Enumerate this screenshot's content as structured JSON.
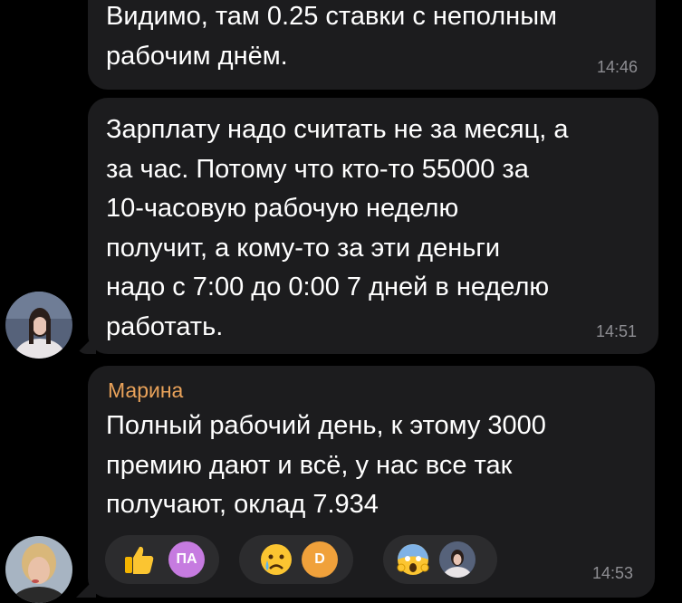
{
  "messages": [
    {
      "text": "Видимо, там 0.25 ставки с неполным\nрабочим днём.",
      "time": "14:46"
    },
    {
      "text": "Зарплату надо считать не за месяц, а\nза час. Потому что кто-то 55000 за\n10-часовую рабочую неделю\nполучит, а кому-то за эти деньги\nнадо с 7:00 до 0:00 7 дней в неделю\nработать.",
      "time": "14:51"
    },
    {
      "sender": "Марина",
      "text": "Полный рабочий день, к этому 3000\nпремию дают и всё, у нас все так\nполучают, оклад 7.934",
      "time": "14:53"
    }
  ],
  "reactions": [
    {
      "emoji": "thumbs-up-icon",
      "reactor_initials": "ПА",
      "reactor_color": "#c67be0"
    },
    {
      "emoji": "crying-face-icon",
      "reactor_initials": "D",
      "reactor_color": "#f0a13b"
    },
    {
      "emoji": "screaming-face-icon",
      "reactor_initials": "",
      "reactor_color": "#2b3a55"
    }
  ],
  "colors": {
    "background": "#000000",
    "bubble": "#1c1c1e",
    "sender_name": "#e9a25a",
    "timestamp": "#8e8e93"
  }
}
